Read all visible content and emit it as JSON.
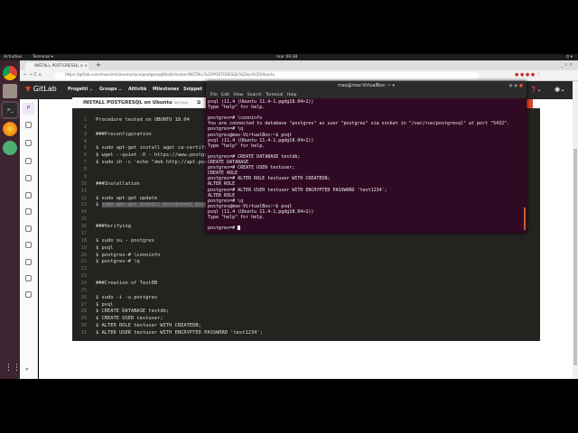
{
  "topbar": {
    "activities": "Activities",
    "app": "Terminal ▾",
    "clock": "mar 09:38"
  },
  "browser": {
    "tab_title": "INSTALL POSTGRESQL o",
    "url": "https://gitlab.com/massimilianomoraca/postgresql/blob/master/INSTALL%20POSTGRESQL%20on%20Ubuntu"
  },
  "gitlab": {
    "logo": "GitLab",
    "nav": [
      "Progetti ⌄",
      "Groups ⌄",
      "Attività",
      "Milestones",
      "Snippet"
    ],
    "sidebar_project_letter": "P",
    "file": {
      "name": "INSTALL POSTGRESQL on Ubuntu",
      "size": "609 Byte"
    }
  },
  "code_lines": [
    "Procedure tested on UBUNTU 18.04",
    "",
    "###Preconfiguration",
    "",
    "$ sudo apt-get install wget ca-certificates",
    "$ wget --quiet -O - https://www.postgresql.org/media/keys/ACCC4CF8.asc | sudo apt-key add -",
    "$ sudo sh -c 'echo \"deb http://apt.postgresql.org/pub/repos/apt/ `lsb_release -cs`-pgdg main\"",
    "",
    "",
    "###Installation",
    "",
    "$ sudo apt-get update",
    "$ sudo apt-get install postgresql postgresql-contrib",
    "",
    "",
    "###Verifying",
    "",
    "$ sudo su - postgres",
    "$ psql",
    "$ postgres-# \\conninfo",
    "$ postgres-# \\q",
    "",
    "",
    "###Creation of TestDB",
    "",
    "$ sudo -i -u postgres",
    "$ psql",
    "$ CREATE DATABASE testdb;",
    "$ CREATE USER testuser;",
    "$ ALTER ROLE testuser WITH CREATEDB;",
    "$ ALTER USER testuser WITH ENCRYPTED PASSWORD 'test1234';"
  ],
  "terminal": {
    "title": "max@max-VirtualBox: ~",
    "menu": "File Edit View Search Terminal Help",
    "lines": [
      "psql (11.4 (Ubuntu 11.4-1.pgdg18.04+1))",
      "Type \"help\" for help.",
      "",
      "postgres=# \\conninfo",
      "You are connected to database \"postgres\" as user \"postgres\" via socket in \"/var/run/postgresql\" at port \"5432\".",
      "postgres=# \\q",
      "postgres@max-VirtualBox:~$ psql",
      "psql (11.4 (Ubuntu 11.4-1.pgdg18.04+1))",
      "Type \"help\" for help.",
      "",
      "postgres=# CREATE DATABASE testdb;",
      "CREATE DATABASE",
      "postgres=# CREATE USER testuser;",
      "CREATE ROLE",
      "postgres=# ALTER ROLE testuser WITH CREATEDB;",
      "ALTER ROLE",
      "postgres=# ALTER USER testuser WITH ENCRYPTED PASSWORD 'test1234';",
      "ALTER ROLE",
      "postgres=# \\q",
      "postgres@max-VirtualBox:~$ psql",
      "psql (11.4 (Ubuntu 11.4-1.pgdg18.04+1))",
      "Type \"help\" for help.",
      ""
    ],
    "prompt": "postgres=# "
  },
  "colors": {
    "gitlab_orange": "#e24329",
    "terminal_bg": "#300a24",
    "code_bg": "#232320"
  }
}
